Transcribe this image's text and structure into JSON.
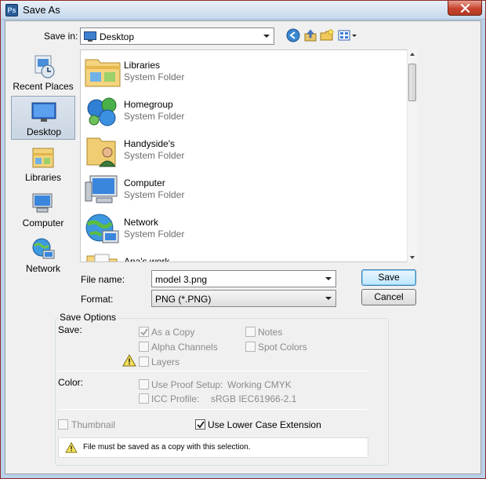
{
  "window": {
    "title": "Save As",
    "app_icon_text": "Ps"
  },
  "toolbar": {
    "save_in_label": "Save in:",
    "save_in_value": "Desktop",
    "icons": [
      "back-arrow-icon",
      "up-folder-icon",
      "new-folder-icon",
      "views-menu-icon"
    ]
  },
  "places": [
    {
      "label": "Recent Places",
      "icon": "recent-places-icon"
    },
    {
      "label": "Desktop",
      "icon": "desktop-icon",
      "active": true
    },
    {
      "label": "Libraries",
      "icon": "libraries-icon"
    },
    {
      "label": "Computer",
      "icon": "computer-icon"
    },
    {
      "label": "Network",
      "icon": "network-icon"
    }
  ],
  "files": [
    {
      "name": "Libraries",
      "type": "System Folder",
      "icon": "libraries-folder-icon"
    },
    {
      "name": "Homegroup",
      "type": "System Folder",
      "icon": "homegroup-icon"
    },
    {
      "name": "Handyside's",
      "type": "System Folder",
      "icon": "user-folder-icon"
    },
    {
      "name": "Computer",
      "type": "System Folder",
      "icon": "computer-icon"
    },
    {
      "name": "Network",
      "type": "System Folder",
      "icon": "network-globe-icon"
    },
    {
      "name": "Ana's work",
      "type": "",
      "icon": "folder-icon"
    }
  ],
  "form": {
    "file_name_label": "File name:",
    "file_name_value": "model 3.png",
    "format_label": "Format:",
    "format_value": "PNG (*.PNG)",
    "save_button": "Save",
    "cancel_button": "Cancel"
  },
  "save_options": {
    "title": "Save Options",
    "save_label": "Save:",
    "as_a_copy": {
      "label": "As a Copy",
      "checked": true,
      "enabled": false
    },
    "alpha_channels": {
      "label": "Alpha Channels",
      "checked": false,
      "enabled": false
    },
    "layers": {
      "label": "Layers",
      "checked": false,
      "enabled": false
    },
    "notes": {
      "label": "Notes",
      "checked": false,
      "enabled": false
    },
    "spot_colors": {
      "label": "Spot Colors",
      "checked": false,
      "enabled": false
    },
    "color_label": "Color:",
    "use_proof_setup": {
      "label": "Use Proof Setup:",
      "value": "Working CMYK",
      "checked": false,
      "enabled": false
    },
    "icc_profile": {
      "label": "ICC Profile:",
      "value": "sRGB IEC61966-2.1",
      "checked": false,
      "enabled": false
    },
    "thumbnail": {
      "label": "Thumbnail",
      "checked": false,
      "enabled": false
    },
    "lower_case_ext": {
      "label": "Use Lower Case Extension",
      "checked": true,
      "enabled": true
    },
    "warning_text": "File must be saved as a copy with this selection."
  },
  "colors": {
    "window_frame": "#b9d1ea",
    "close_button": "#c7432e",
    "default_button_border": "#3c7fb1",
    "secondary_text": "#6d6d6d"
  }
}
